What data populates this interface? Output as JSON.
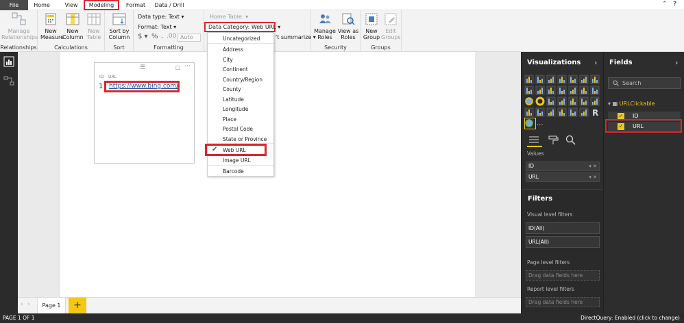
{
  "tabs": [
    {
      "label": "File"
    },
    {
      "label": "Home"
    },
    {
      "label": "View"
    },
    {
      "label": "Modeling"
    },
    {
      "label": "Format"
    },
    {
      "label": "Data / Drill"
    }
  ],
  "ribbon": {
    "relationships": {
      "manage_label": "Manage\nRelationships",
      "group": "Relationships"
    },
    "calculations": {
      "measure": "New\nMeasure",
      "column": "New\nColumn",
      "table": "New\nTable",
      "group": "Calculations"
    },
    "sort": {
      "sort_by": "Sort by\nColumn",
      "group": "Sort"
    },
    "formatting": {
      "data_type": "Data type: Text",
      "format": "Format: Text",
      "auto": "Auto",
      "group": "Formatting"
    },
    "properties": {
      "home_table": "Home Table:",
      "data_category": "Data Category: Web URL",
      "summarize": "'t summarize"
    },
    "security": {
      "manage_roles": "Manage\nRoles",
      "view_as": "View as\nRoles",
      "group": "Security"
    },
    "groups": {
      "new_group": "New\nGroup",
      "edit_groups": "Edit\nGroups",
      "group": "Groups"
    }
  },
  "visual": {
    "col_id": "ID",
    "col_url": "URL",
    "row_id": "1",
    "row_url": "https://www.bing.com/"
  },
  "dropdown": {
    "items": [
      "Uncategorized",
      "Address",
      "City",
      "Continent",
      "Country/Region",
      "County",
      "Latitude",
      "Longitude",
      "Place",
      "Postal Code",
      "State or Province",
      "Web URL",
      "Image URL",
      "Barcode"
    ],
    "selected": "Web URL"
  },
  "pages": {
    "tab": "Page 1",
    "add": "+"
  },
  "status": {
    "page": "PAGE 1 OF 1",
    "directquery": "DirectQuery: Enabled (click to change)"
  },
  "visualizations": {
    "title": "Visualizations",
    "values_label": "Values",
    "wells": [
      "ID",
      "URL"
    ],
    "filters_title": "Filters",
    "visual_level": "Visual level filters",
    "filter_items": [
      "ID(All)",
      "URL(All)"
    ],
    "page_level": "Page level filters",
    "drag": "Drag data fields here",
    "report_level": "Report level filters"
  },
  "fields": {
    "title": "Fields",
    "search_placeholder": "Search",
    "table": "URLClickable",
    "items": [
      "ID",
      "URL"
    ]
  },
  "colors": {
    "accent": "#f2c811",
    "highlight": "#d7282f",
    "pane": "#2d2d2d"
  }
}
